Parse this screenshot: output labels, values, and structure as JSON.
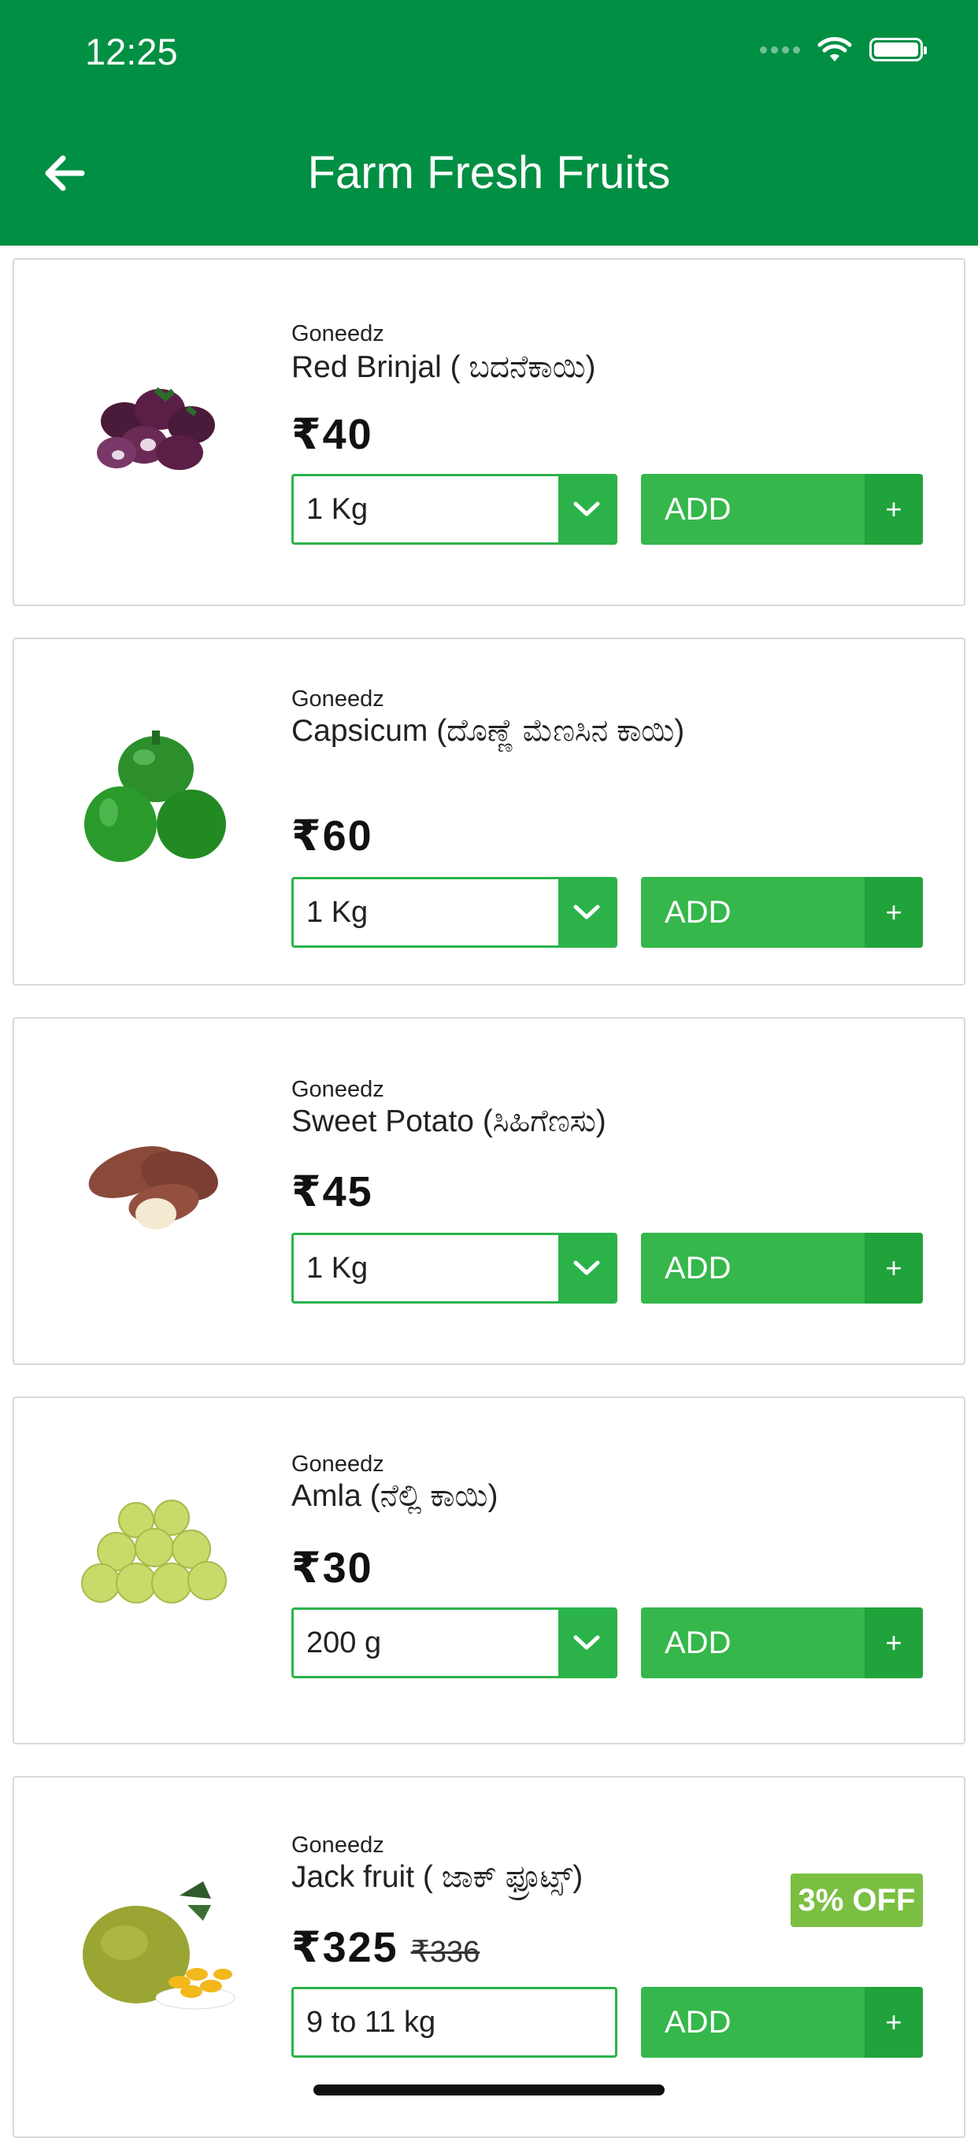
{
  "status": {
    "time": "12:25"
  },
  "header": {
    "title": "Farm Fresh Fruits",
    "back_icon": "arrow-left-icon"
  },
  "products": [
    {
      "brand": "Goneedz",
      "name": "Red Brinjal ( ಬದನೆಕಾಯಿ)",
      "price": "₹40",
      "qty": "1 Kg",
      "add_label": "ADD",
      "plus": "+"
    },
    {
      "brand": "Goneedz",
      "name": "Capsicum (ದೊಣ್ಣೆ ಮೆಣಸಿನ ಕಾಯಿ)",
      "price": "₹60",
      "qty": "1 Kg",
      "add_label": "ADD",
      "plus": "+"
    },
    {
      "brand": "Goneedz",
      "name": "Sweet Potato (ಸಿಹಿಗೆಣಸು)",
      "price": "₹45",
      "qty": "1 Kg",
      "add_label": "ADD",
      "plus": "+"
    },
    {
      "brand": "Goneedz",
      "name": "Amla (ನೆಲ್ಲಿ ಕಾಯಿ)",
      "price": "₹30",
      "qty": "200 g",
      "add_label": "ADD",
      "plus": "+"
    },
    {
      "brand": "Goneedz",
      "name": "Jack fruit ( ಜಾಕ್ ಫ್ರೂಟ್ಸ್)",
      "price": "₹325",
      "old_price": "₹336",
      "discount": "3% OFF",
      "qty": "9 to 11 kg",
      "add_label": "ADD",
      "plus": "+"
    }
  ],
  "colors": {
    "header": "#008f43",
    "button": "#35b74b",
    "button_dark": "#20a33a",
    "badge": "#7bbf42"
  }
}
